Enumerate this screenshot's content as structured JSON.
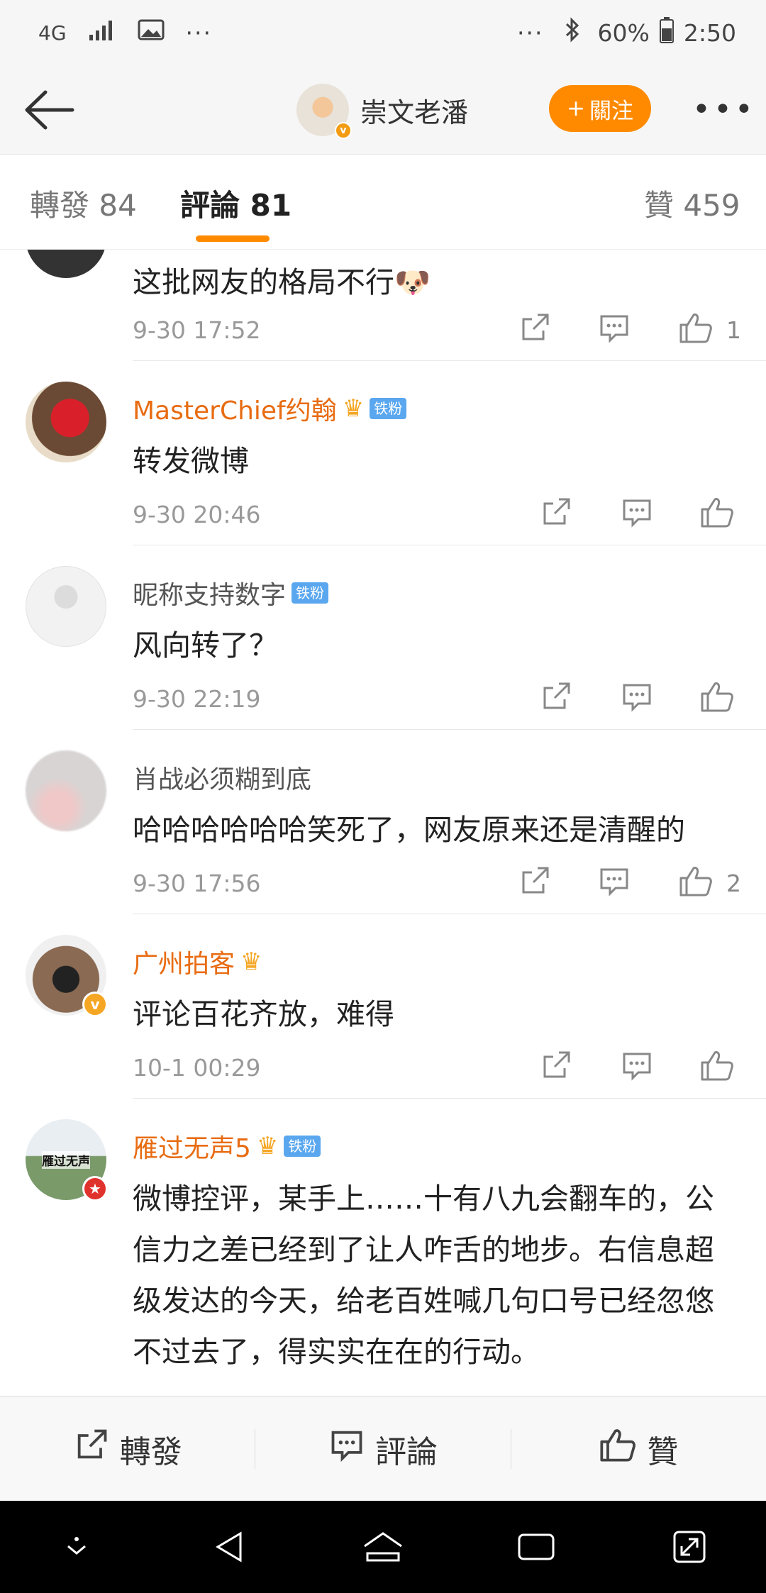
{
  "status_bar": {
    "network": "4G",
    "dots_left": "···",
    "dots_right": "···",
    "battery": "60%",
    "time": "2:50"
  },
  "header": {
    "profile_name": "崇文老潘",
    "follow_label": "關注",
    "follow_plus": "+",
    "more_label": "•••"
  },
  "tabs": [
    {
      "label": "轉發 84"
    },
    {
      "label": "評論 81"
    },
    {
      "label": "贊 459"
    }
  ],
  "comments": [
    {
      "user": "",
      "text": "这批网友的格局不行🐶",
      "date": "9-30 17:52",
      "likes": "1"
    },
    {
      "user": "MasterChief约翰",
      "badge": "铁粉",
      "text": "转发微博",
      "date": "9-30 20:46",
      "likes": ""
    },
    {
      "user": "昵称支持数字",
      "badge": "铁粉",
      "text": "风向转了？",
      "date": "9-30 22:19",
      "likes": ""
    },
    {
      "user": "肖战必须糊到底",
      "text": "哈哈哈哈哈哈笑死了，网友原来还是清醒的",
      "date": "9-30 17:56",
      "likes": "2"
    },
    {
      "user": "广州拍客",
      "text": "评论百花齐放，难得",
      "date": "10-1 00:29",
      "likes": ""
    },
    {
      "user": "雁过无声5",
      "badge": "铁粉",
      "avatar_text": "雁过无声",
      "text": "微博控评，某手上……十有八九会翻车的，公信力之差已经到了让人咋舌的地步。右信息超级发达的今天，给老百姓喊几句口号已经忽悠不过去了，得实实在在的行动。",
      "date": "",
      "likes": ""
    }
  ],
  "bottom_bar": {
    "repost": "轉發",
    "comment": "評論",
    "like": "贊"
  },
  "colors": {
    "accent": "#ff8a00",
    "username_orange": "#e86c12",
    "fan_badge": "#5aa7ef"
  }
}
